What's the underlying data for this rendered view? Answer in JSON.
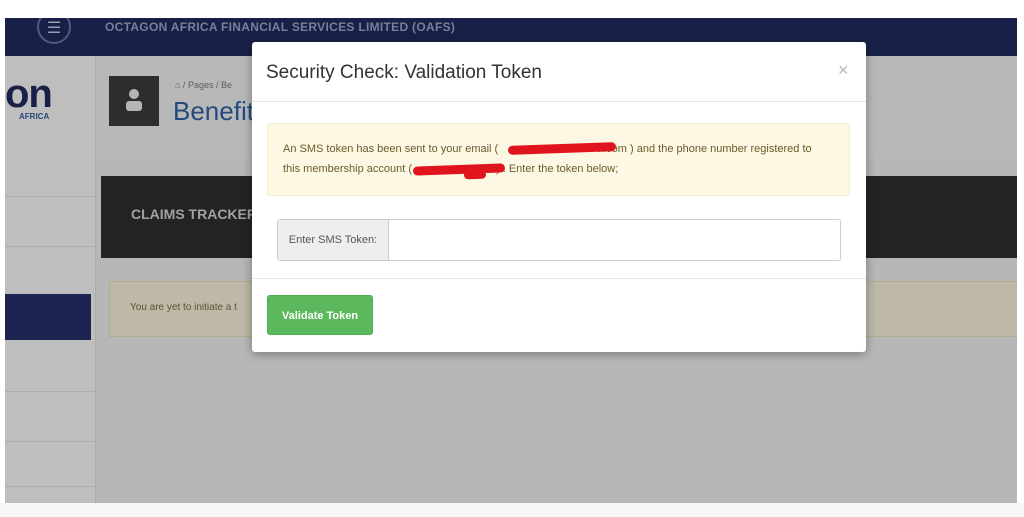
{
  "topbar": {
    "company_name": "OCTAGON AFRICA FINANCIAL SERVICES LIMITED (OAFS)",
    "menu_icon": "hamburger-icon"
  },
  "sidebar": {
    "logo_text": "on",
    "logo_subtext": "AFRICA"
  },
  "header": {
    "breadcrumb": "⌂ / Pages / Be",
    "title": "Benefit",
    "avatar_icon": "user-icon"
  },
  "main": {
    "claims_label": "CLAIMS TRACKER",
    "notice_text": "You are yet to initiate a t"
  },
  "modal": {
    "title": "Security Check: Validation Token",
    "close_label": "×",
    "message_line1_prefix": "An SMS token has been sent to your email (",
    "message_line1_suffix": "il.com ) and the phone number registered to",
    "message_line2_prefix": "this membership account (",
    "message_line2_suffix": ") . Enter the token below;",
    "token_label": "Enter SMS Token:",
    "token_value": "",
    "validate_button": "Validate Token"
  },
  "colors": {
    "topbar": "#1f2a5c",
    "title_blue": "#2f5fa0",
    "alert_bg": "#fcf8e3",
    "success": "#5cb85c",
    "redaction": "#e0141d"
  }
}
